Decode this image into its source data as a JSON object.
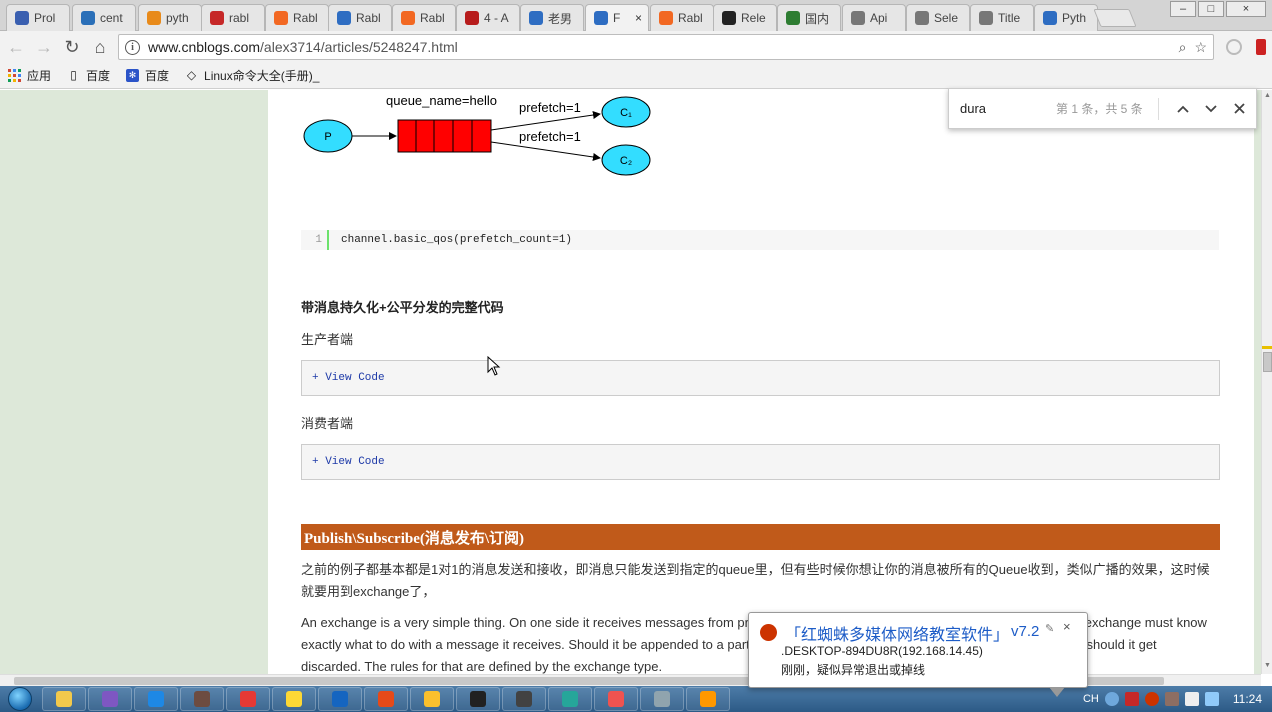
{
  "tabs": [
    {
      "label": "Prol",
      "icon": "dialog-icon",
      "color": "#3a5fb0"
    },
    {
      "label": "cent",
      "icon": "globe-icon",
      "color": "#2a6fb8"
    },
    {
      "label": "pyth",
      "icon": "rss-icon",
      "color": "#e88a1a"
    },
    {
      "label": "rabl",
      "icon": "c-icon",
      "color": "#c62828"
    },
    {
      "label": "Rabl",
      "icon": "rabbitmq-icon",
      "color": "#f26822"
    },
    {
      "label": "Rabl",
      "icon": "blog-icon",
      "color": "#2e6dc2"
    },
    {
      "label": "Rabl",
      "icon": "rabbitmq-icon",
      "color": "#f26822"
    },
    {
      "label": "4 - A",
      "icon": "dots-icon",
      "color": "#b71c1c"
    },
    {
      "label": "老男",
      "icon": "blog-icon",
      "color": "#2e6dc2"
    },
    {
      "label": "F",
      "icon": "blog-icon",
      "color": "#2e6dc2",
      "active": true
    },
    {
      "label": "Rabl",
      "icon": "rabbitmq-icon",
      "color": "#f26822"
    },
    {
      "label": "Rele",
      "icon": "github-icon",
      "color": "#222222"
    },
    {
      "label": "国内",
      "icon": "page-icon",
      "color": "#2e7d32"
    },
    {
      "label": "Api",
      "icon": "page-icon",
      "color": "#777777"
    },
    {
      "label": "Sele",
      "icon": "page-icon",
      "color": "#777777"
    },
    {
      "label": "Title",
      "icon": "page-icon",
      "color": "#777777"
    },
    {
      "label": "Pyth",
      "icon": "blog-icon",
      "color": "#2e6dc2"
    }
  ],
  "tab_close": "×",
  "window": {
    "minimize": "–",
    "maximize": "□",
    "close": "×"
  },
  "toolbar": {
    "back": "←",
    "forward": "→",
    "reload": "↻",
    "home": "⌂",
    "url_host": "www.cnblogs.com",
    "url_path": "/alex3714/articles/5248247.html",
    "search_glyph": "⌕",
    "star_glyph": "☆"
  },
  "bookmarks": [
    {
      "label": "应用",
      "icon": "apps-grid-icon"
    },
    {
      "label": "百度",
      "icon": "page-icon"
    },
    {
      "label": "百度",
      "icon": "paw-icon"
    },
    {
      "label": "Linux命令大全(手册)_",
      "icon": "diamond-icon"
    }
  ],
  "diagram": {
    "queue_label": "queue_name=hello",
    "producer": "P",
    "consumer1": "C₁",
    "consumer2": "C₂",
    "prefetch1": "prefetch=1",
    "prefetch2": "prefetch=1",
    "colors": {
      "node": "#33ddff",
      "queue": "#ff0000"
    }
  },
  "code": {
    "line_no": "1",
    "text": "channel.basic_qos(prefetch_count=1)"
  },
  "sections": {
    "complete_code_heading": "带消息持久化+公平分发的完整代码",
    "producer_label": "生产者端",
    "consumer_label": "消费者端",
    "view_code": "+ View Code",
    "publish_heading": "Publish\\Subscribe(消息发布\\订阅)",
    "para1": "之前的例子都基本都是1对1的消息发送和接收，即消息只能发送到指定的queue里，但有些时候你想让你的消息被所有的Queue收到，类似广播的效果，这时候就要用到exchange了，",
    "para2": "An exchange is a very simple thing. On one side it receives messages from producers and the other side it pushes them to queues. The exchange must know exactly what to do with a message it receives. Should it be appended to a particular queue? Should it be appended to many queues? Or should it get discarded. The rules for that are defined by the exchange type."
  },
  "find": {
    "query": "dura",
    "count": "第 1 条，共 5 条",
    "prev": "⌃",
    "next": "⌄",
    "close": "×"
  },
  "notification": {
    "title": "「红蜘蛛多媒体网络教室软件」",
    "version": "v7.2",
    "pin": "✎",
    "close": "×",
    "line1": ".DESKTOP-894DU8R(192.168.14.45)",
    "line2": "刚刚，疑似异常退出或掉线"
  },
  "taskbar": {
    "apps": [
      "folder-icon",
      "paint-icon",
      "save-icon",
      "tools-icon",
      "chrome-icon",
      "notepad-icon",
      "word-icon",
      "powerpoint-icon",
      "explorer-icon",
      "pycharm-icon",
      "terminal-icon",
      "app-icon",
      "bird-icon",
      "search-app-icon",
      "orange-app-icon"
    ],
    "lang": "CH",
    "clock": "11:24"
  }
}
